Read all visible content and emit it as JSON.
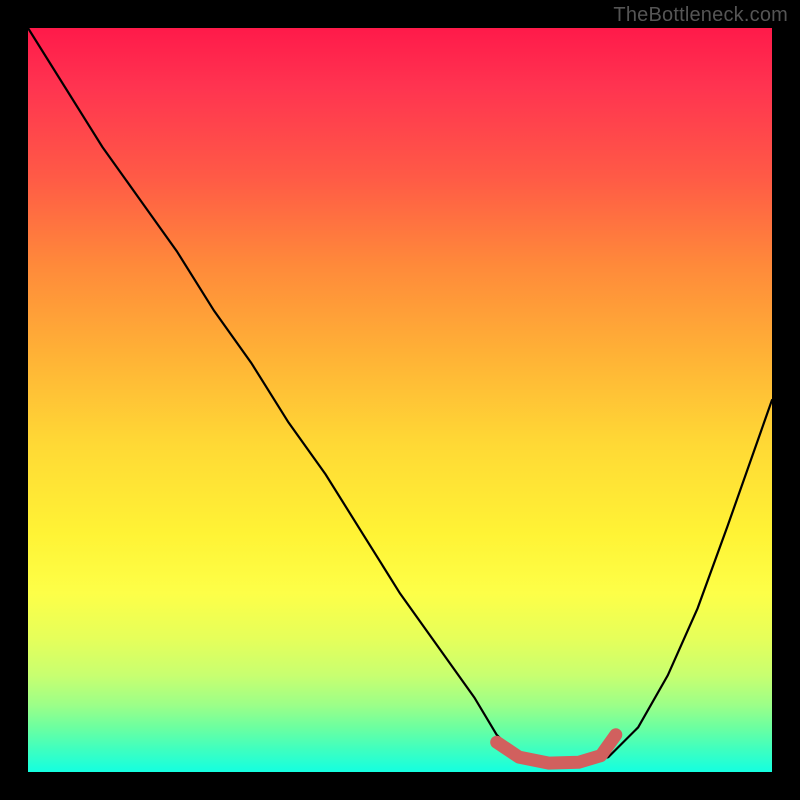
{
  "watermark": "TheBottleneck.com",
  "chart_data": {
    "type": "line",
    "title": "",
    "xlabel": "",
    "ylabel": "",
    "xlim": [
      0,
      100
    ],
    "ylim": [
      0,
      100
    ],
    "series": [
      {
        "name": "bottleneck-curve",
        "x": [
          0,
          5,
          10,
          15,
          20,
          25,
          30,
          35,
          40,
          45,
          50,
          55,
          60,
          63,
          66,
          70,
          74,
          78,
          82,
          86,
          90,
          94,
          100
        ],
        "values": [
          100,
          92,
          84,
          77,
          70,
          62,
          55,
          47,
          40,
          32,
          24,
          17,
          10,
          5,
          2,
          1,
          1,
          2,
          6,
          13,
          22,
          33,
          50
        ]
      },
      {
        "name": "optimal-marker",
        "x": [
          63,
          66,
          70,
          74,
          77,
          79
        ],
        "values": [
          4,
          2,
          1.2,
          1.3,
          2.2,
          5
        ]
      }
    ],
    "colors": {
      "curve": "#000000",
      "marker": "#d1605e",
      "gradient_top": "#ff1a4a",
      "gradient_bottom": "#14ffe0"
    }
  }
}
